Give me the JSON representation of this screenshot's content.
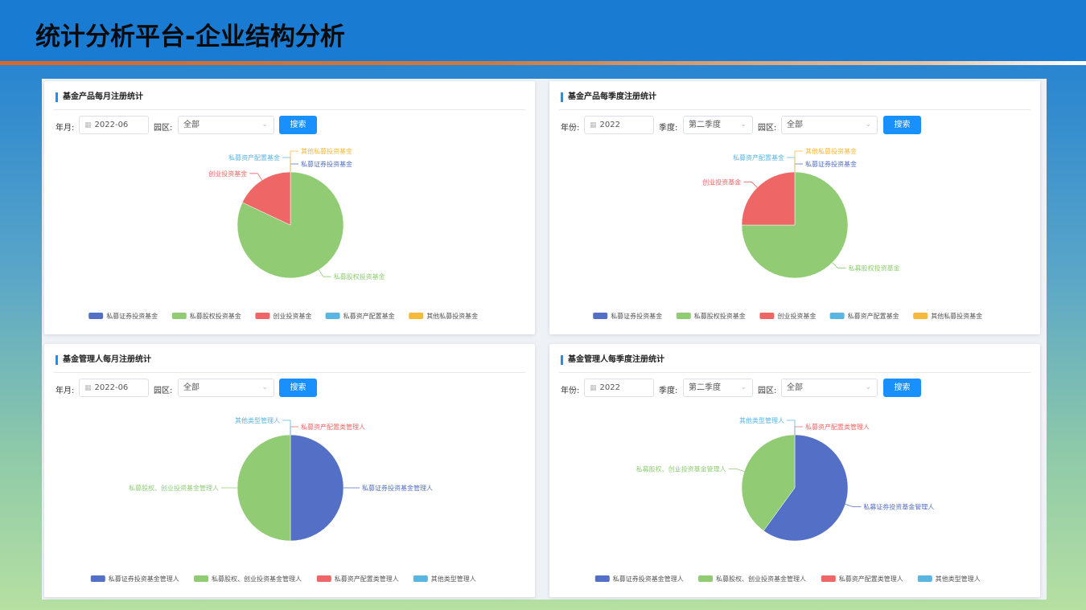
{
  "header": {
    "title": "统计分析平台-企业结构分析"
  },
  "colors": {
    "blue": "#5470c6",
    "green": "#91cc75",
    "red": "#ee6666",
    "cyan": "#5ab6e0",
    "yellow": "#f5b93b",
    "accent": "#1890ff"
  },
  "panels": [
    {
      "title": "基金产品每月注册统计",
      "filters": {
        "date_label": "年月:",
        "date_value": "2022-06",
        "park_label": "园区:",
        "park_value": "全部",
        "search_label": "搜索"
      },
      "chart_data": {
        "type": "pie",
        "title": "",
        "series": [
          {
            "name": "私募证券投资基金",
            "value": 0,
            "color": "#5470c6"
          },
          {
            "name": "私募股权投资基金",
            "value": 82,
            "color": "#91cc75"
          },
          {
            "name": "创业投资基金",
            "value": 18,
            "color": "#ee6666"
          },
          {
            "name": "私募资产配置基金",
            "value": 0,
            "color": "#5ab6e0"
          },
          {
            "name": "其他私募投资基金",
            "value": 0,
            "color": "#f5b93b"
          }
        ],
        "legend_position": "bottom"
      }
    },
    {
      "title": "基金产品每季度注册统计",
      "filters": {
        "year_label": "年份:",
        "year_value": "2022",
        "quarter_label": "季度:",
        "quarter_value": "第二季度",
        "park_label": "园区:",
        "park_value": "全部",
        "search_label": "搜索"
      },
      "chart_data": {
        "type": "pie",
        "title": "",
        "series": [
          {
            "name": "私募证券投资基金",
            "value": 0,
            "color": "#5470c6"
          },
          {
            "name": "私募股权投资基金",
            "value": 75,
            "color": "#91cc75"
          },
          {
            "name": "创业投资基金",
            "value": 25,
            "color": "#ee6666"
          },
          {
            "name": "私募资产配置基金",
            "value": 0,
            "color": "#5ab6e0"
          },
          {
            "name": "其他私募投资基金",
            "value": 0,
            "color": "#f5b93b"
          }
        ],
        "legend_position": "bottom"
      }
    },
    {
      "title": "基金管理人每月注册统计",
      "filters": {
        "date_label": "年月:",
        "date_value": "2022-06",
        "park_label": "园区:",
        "park_value": "全部",
        "search_label": "搜索"
      },
      "chart_data": {
        "type": "pie",
        "title": "",
        "series": [
          {
            "name": "私募证券投资基金管理人",
            "value": 50,
            "color": "#5470c6"
          },
          {
            "name": "私募股权、创业投资基金管理人",
            "value": 50,
            "color": "#91cc75"
          },
          {
            "name": "私募资产配置类管理人",
            "value": 0,
            "color": "#ee6666"
          },
          {
            "name": "其他类型管理人",
            "value": 0,
            "color": "#5ab6e0"
          }
        ],
        "legend_position": "bottom"
      }
    },
    {
      "title": "基金管理人每季度注册统计",
      "filters": {
        "year_label": "年份:",
        "year_value": "2022",
        "quarter_label": "季度:",
        "quarter_value": "第二季度",
        "park_label": "园区:",
        "park_value": "全部",
        "search_label": "搜索"
      },
      "chart_data": {
        "type": "pie",
        "title": "",
        "series": [
          {
            "name": "私募证券投资基金管理人",
            "value": 60,
            "color": "#5470c6"
          },
          {
            "name": "私募股权、创业投资基金管理人",
            "value": 40,
            "color": "#91cc75"
          },
          {
            "name": "私募资产配置类管理人",
            "value": 0,
            "color": "#ee6666"
          },
          {
            "name": "其他类型管理人",
            "value": 0,
            "color": "#5ab6e0"
          }
        ],
        "legend_position": "bottom"
      }
    }
  ]
}
